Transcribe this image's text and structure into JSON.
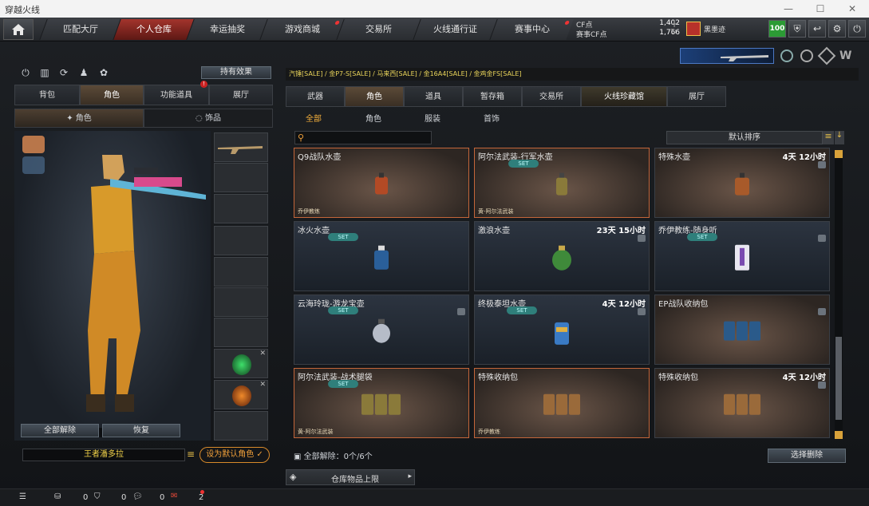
{
  "window": {
    "title": "穿越火线"
  },
  "topnav": {
    "tabs": [
      "匹配大厅",
      "个人仓库",
      "幸运抽奖",
      "游戏商城",
      "交易所",
      "火线通行证",
      "赛事中心"
    ],
    "cf_label": "CF点",
    "cf_value": "1,402",
    "event_cf_label": "赛事CF点",
    "event_cf_value": "1,766",
    "player_name": "黑墨迹",
    "level": "100"
  },
  "left": {
    "effects_button": "持有效果",
    "tabs": [
      "背包",
      "角色",
      "功能道具",
      "展厅"
    ],
    "subtabs": [
      "角色",
      "饰品"
    ],
    "remove_all": "全部解除",
    "restore": "恢复",
    "character_name": "王者潘多拉",
    "set_default": "设为默认角色"
  },
  "right": {
    "notice": "汽锤[SALE] / 金P7-S[SALE] / 马来西[SALE] / 金16A4[SALE] / 金鸡金FS[SALE]",
    "tabs": [
      "武器",
      "角色",
      "道具",
      "暂存箱",
      "交易所",
      "火线珍藏馆",
      "展厅"
    ],
    "filters": [
      "全部",
      "角色",
      "服装",
      "首饰"
    ],
    "sort_label": "默认排序",
    "status": "全部解除：0个/6个",
    "select_delete": "选择删除",
    "warehouse_limit": "仓库物品上限",
    "items": [
      {
        "name": "Q9战队水壶",
        "time": "",
        "set": "",
        "tag": "乔伊教练"
      },
      {
        "name": "阿尔法武装-行军水壶",
        "time": "",
        "set": "SET",
        "tag": "黄-阿尔法武装"
      },
      {
        "name": "特殊水壶",
        "time": "4天 12小时",
        "set": "",
        "tag": ""
      },
      {
        "name": "冰火水壶",
        "time": "",
        "set": "SET",
        "tag": ""
      },
      {
        "name": "激浪水壶",
        "time": "23天 15小时",
        "set": "",
        "tag": ""
      },
      {
        "name": "乔伊教练-随身听",
        "time": "",
        "set": "SET",
        "tag": ""
      },
      {
        "name": "云海玲珑-游龙宝壶",
        "time": "",
        "set": "SET",
        "tag": ""
      },
      {
        "name": "终极泰坦水壶",
        "time": "4天 12小时",
        "set": "SET",
        "tag": ""
      },
      {
        "name": "EP战队收纳包",
        "time": "",
        "set": "",
        "tag": ""
      },
      {
        "name": "阿尔法武装-战术腿袋",
        "time": "",
        "set": "SET",
        "tag": "黄-阿尔法武装"
      },
      {
        "name": "特殊收纳包",
        "time": "",
        "set": "",
        "tag": "乔伊教练"
      },
      {
        "name": "特殊收纳包",
        "time": "4天 12小时",
        "set": "",
        "tag": ""
      }
    ]
  },
  "bottom": {
    "count_a": "0",
    "count_b": "0",
    "count_c": "0",
    "count_d": "2"
  }
}
